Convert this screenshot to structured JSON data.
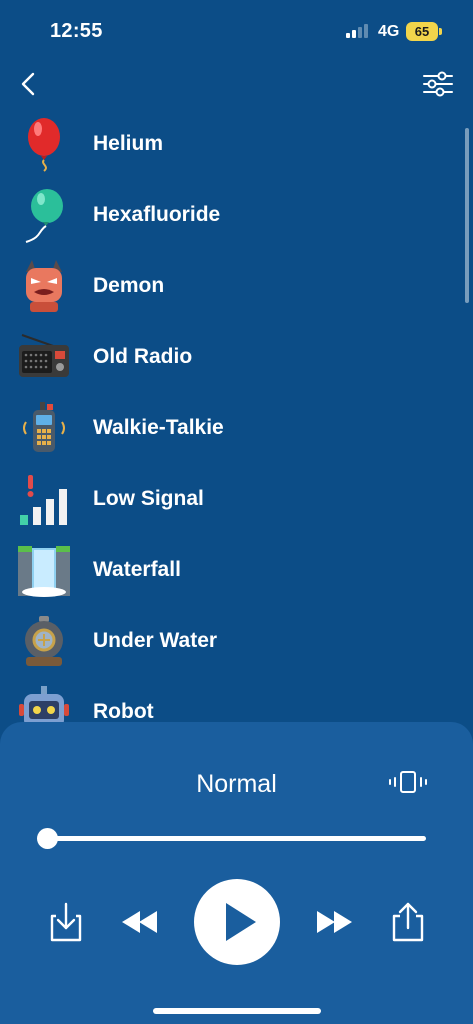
{
  "status_bar": {
    "time": "12:55",
    "network": "4G",
    "battery": "65"
  },
  "list": {
    "items": [
      {
        "label": "Helium",
        "icon": "red-balloon-icon"
      },
      {
        "label": "Hexafluoride",
        "icon": "teal-balloon-icon"
      },
      {
        "label": "Demon",
        "icon": "demon-icon"
      },
      {
        "label": "Old Radio",
        "icon": "radio-icon"
      },
      {
        "label": "Walkie-Talkie",
        "icon": "walkie-talkie-icon"
      },
      {
        "label": "Low Signal",
        "icon": "low-signal-icon"
      },
      {
        "label": "Waterfall",
        "icon": "waterfall-icon"
      },
      {
        "label": "Under Water",
        "icon": "diving-helmet-icon"
      },
      {
        "label": "Robot",
        "icon": "robot-icon"
      }
    ]
  },
  "player": {
    "mode": "Normal",
    "progress": 0.0
  },
  "colors": {
    "background": "#0c4d87",
    "panel": "#1a5e9e",
    "battery": "#f2d54b"
  }
}
